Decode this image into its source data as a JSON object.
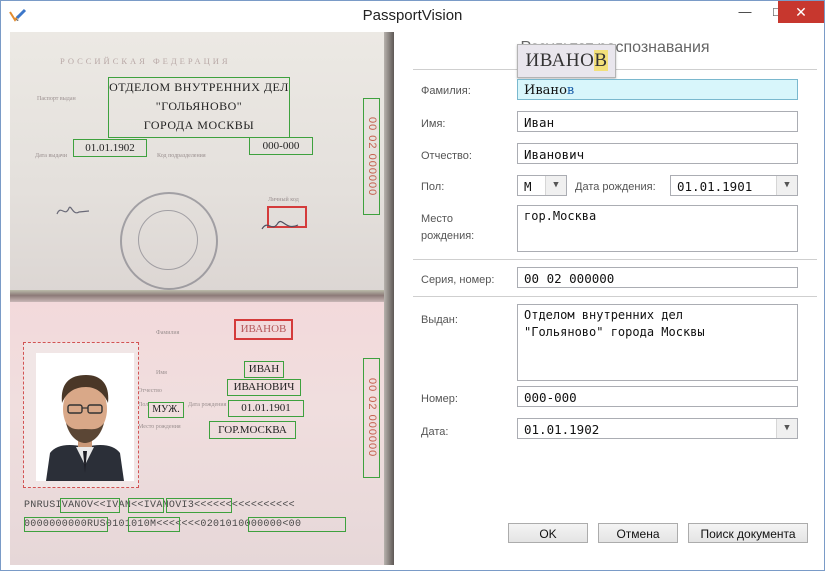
{
  "window": {
    "title": "PassportVision",
    "minimize": "—",
    "maximize": "□",
    "close": "✕"
  },
  "app_icon": "pencil-check-icon",
  "passport": {
    "country_header": "РОССИЙСКАЯ ФЕДЕРАЦИЯ",
    "labels": {
      "issued_by": "Паспорт выдан",
      "issue_date": "Дата выдачи",
      "subdivision_code": "Код подразделения",
      "personal_code": "Личный код",
      "surname": "Фамилия",
      "name": "Имя",
      "patronymic": "Отчество",
      "sex": "Пол",
      "birth_date": "Дата рождения",
      "birth_place": "Место рождения"
    },
    "issued_by_lines": [
      "ОТДЕЛОМ ВНУТРЕННИХ ДЕЛ",
      "\"ГОЛЬЯНОВО\"",
      "ГОРОДА МОСКВЫ"
    ],
    "issue_date": "01.01.1902",
    "subdivision_code": "000-000",
    "series_number_vertical": "00 02 000000",
    "surname": "ИВАНОВ",
    "name": "ИВАН",
    "patronymic": "ИВАНОВИЧ",
    "sex": "МУЖ.",
    "birth_date": "01.01.1901",
    "birth_place": "ГОР.МОСКВА",
    "mrz_line1": "PNRUSIVANOV<<IVAN<<IVANOVI3<<<<<<<<<<<<<<<<",
    "mrz_line2": "0000000000RUS0101010M<<<<<<<0201010000000<00"
  },
  "form": {
    "title": "Результат распознавания",
    "zoom_preview": {
      "before": "ИВАНО",
      "current": "В"
    },
    "labels": {
      "surname": "Фамилия:",
      "name": "Имя:",
      "patronymic": "Отчество:",
      "sex": "Пол:",
      "birth_date": "Дата рождения:",
      "birth_place_1": "Место",
      "birth_place_2": "рождения:",
      "series_number": "Серия, номер:",
      "issued_by": "Выдан:",
      "number": "Номер:",
      "date": "Дата:"
    },
    "values": {
      "surname_before": "Ивано",
      "surname_caret": "в",
      "name": "Иван",
      "patronymic": "Иванович",
      "sex": "М",
      "birth_date": "01.01.1901",
      "birth_place": "гор.Москва",
      "series_number": "00 02 000000",
      "issued_by_line1": "Отделом внутренних дел",
      "issued_by_line2": "\"Гольяново\" города Москвы",
      "number": "000-000",
      "date": "01.01.1902"
    },
    "buttons": {
      "ok": "OK",
      "cancel": "Отмена",
      "search": "Поиск документа"
    }
  }
}
